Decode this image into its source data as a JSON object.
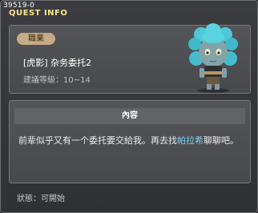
{
  "window": {
    "quest_id": "39519-0",
    "title": "QUEST INFO"
  },
  "quest": {
    "job_badge": "職業",
    "name": "[虎影] 杂务委托2",
    "level_label": "建議等級",
    "level_range": "10~14"
  },
  "content": {
    "header": "內容",
    "desc_before": "前辈似乎又有一个委托要交給我。再去找",
    "npc_name": "帕拉希",
    "desc_after": "聊聊吧。"
  },
  "status": {
    "label": "狀態",
    "value": "可開始"
  },
  "colors": {
    "title": "#fde68a",
    "highlight": "#7fd0f2",
    "badge": "#c6ab86"
  }
}
